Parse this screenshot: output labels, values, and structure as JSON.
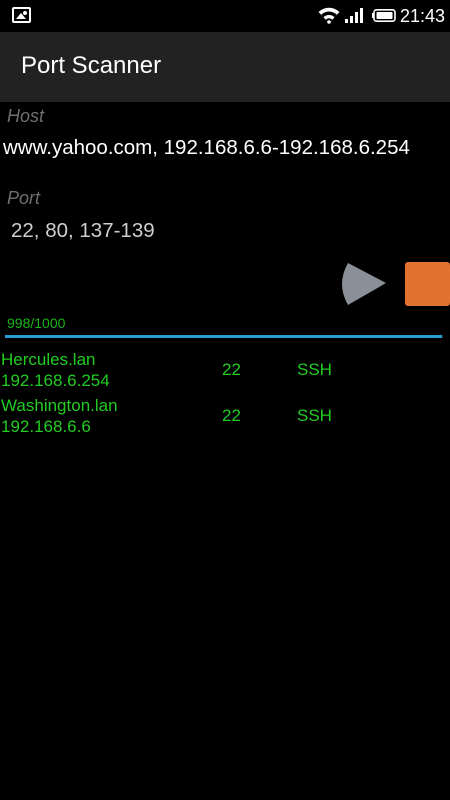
{
  "status_bar": {
    "time": "21:43",
    "icons": [
      "gallery-icon",
      "wifi-icon",
      "signal-icon",
      "battery-icon"
    ]
  },
  "action_bar": {
    "title": "Port Scanner"
  },
  "form": {
    "host_label": "Host",
    "host_value": "www.yahoo.com, 192.168.6.6-192.168.6.254",
    "port_label": "Port",
    "port_value": "22, 80, 137-139"
  },
  "controls": {
    "start_icon": "play-icon",
    "stop_icon": "stop-icon"
  },
  "progress": {
    "text": "998/1000",
    "fraction": 0.998
  },
  "results": [
    {
      "hostname": "Hercules.lan",
      "ip": "192.168.6.254",
      "port": "22",
      "service": "SSH"
    },
    {
      "hostname": "Washington.lan",
      "ip": "192.168.6.6",
      "port": "22",
      "service": "SSH"
    }
  ],
  "colors": {
    "background": "#000000",
    "action_bar": "#222222",
    "accent_green": "#22cc22",
    "progress_blue": "#2a9ad2",
    "stop_orange": "#e2732e",
    "play_grey": "#8a9097"
  }
}
